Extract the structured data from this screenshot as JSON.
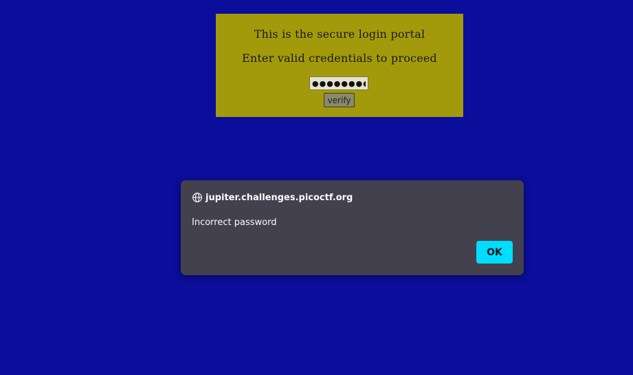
{
  "colors": {
    "page_background": "#0b0d9b",
    "panel_background": "#a39a0b",
    "dialog_background": "#42414d",
    "ok_button": "#00ddff"
  },
  "login_panel": {
    "heading": "This is the secure login portal",
    "subheading": "Enter valid credentials to proceed",
    "password_value": "●●●●●●●●",
    "verify_label": "verify"
  },
  "alert_dialog": {
    "origin_icon": "globe-icon",
    "origin": "jupiter.challenges.picoctf.org",
    "message": "Incorrect password",
    "ok_label": "OK"
  }
}
